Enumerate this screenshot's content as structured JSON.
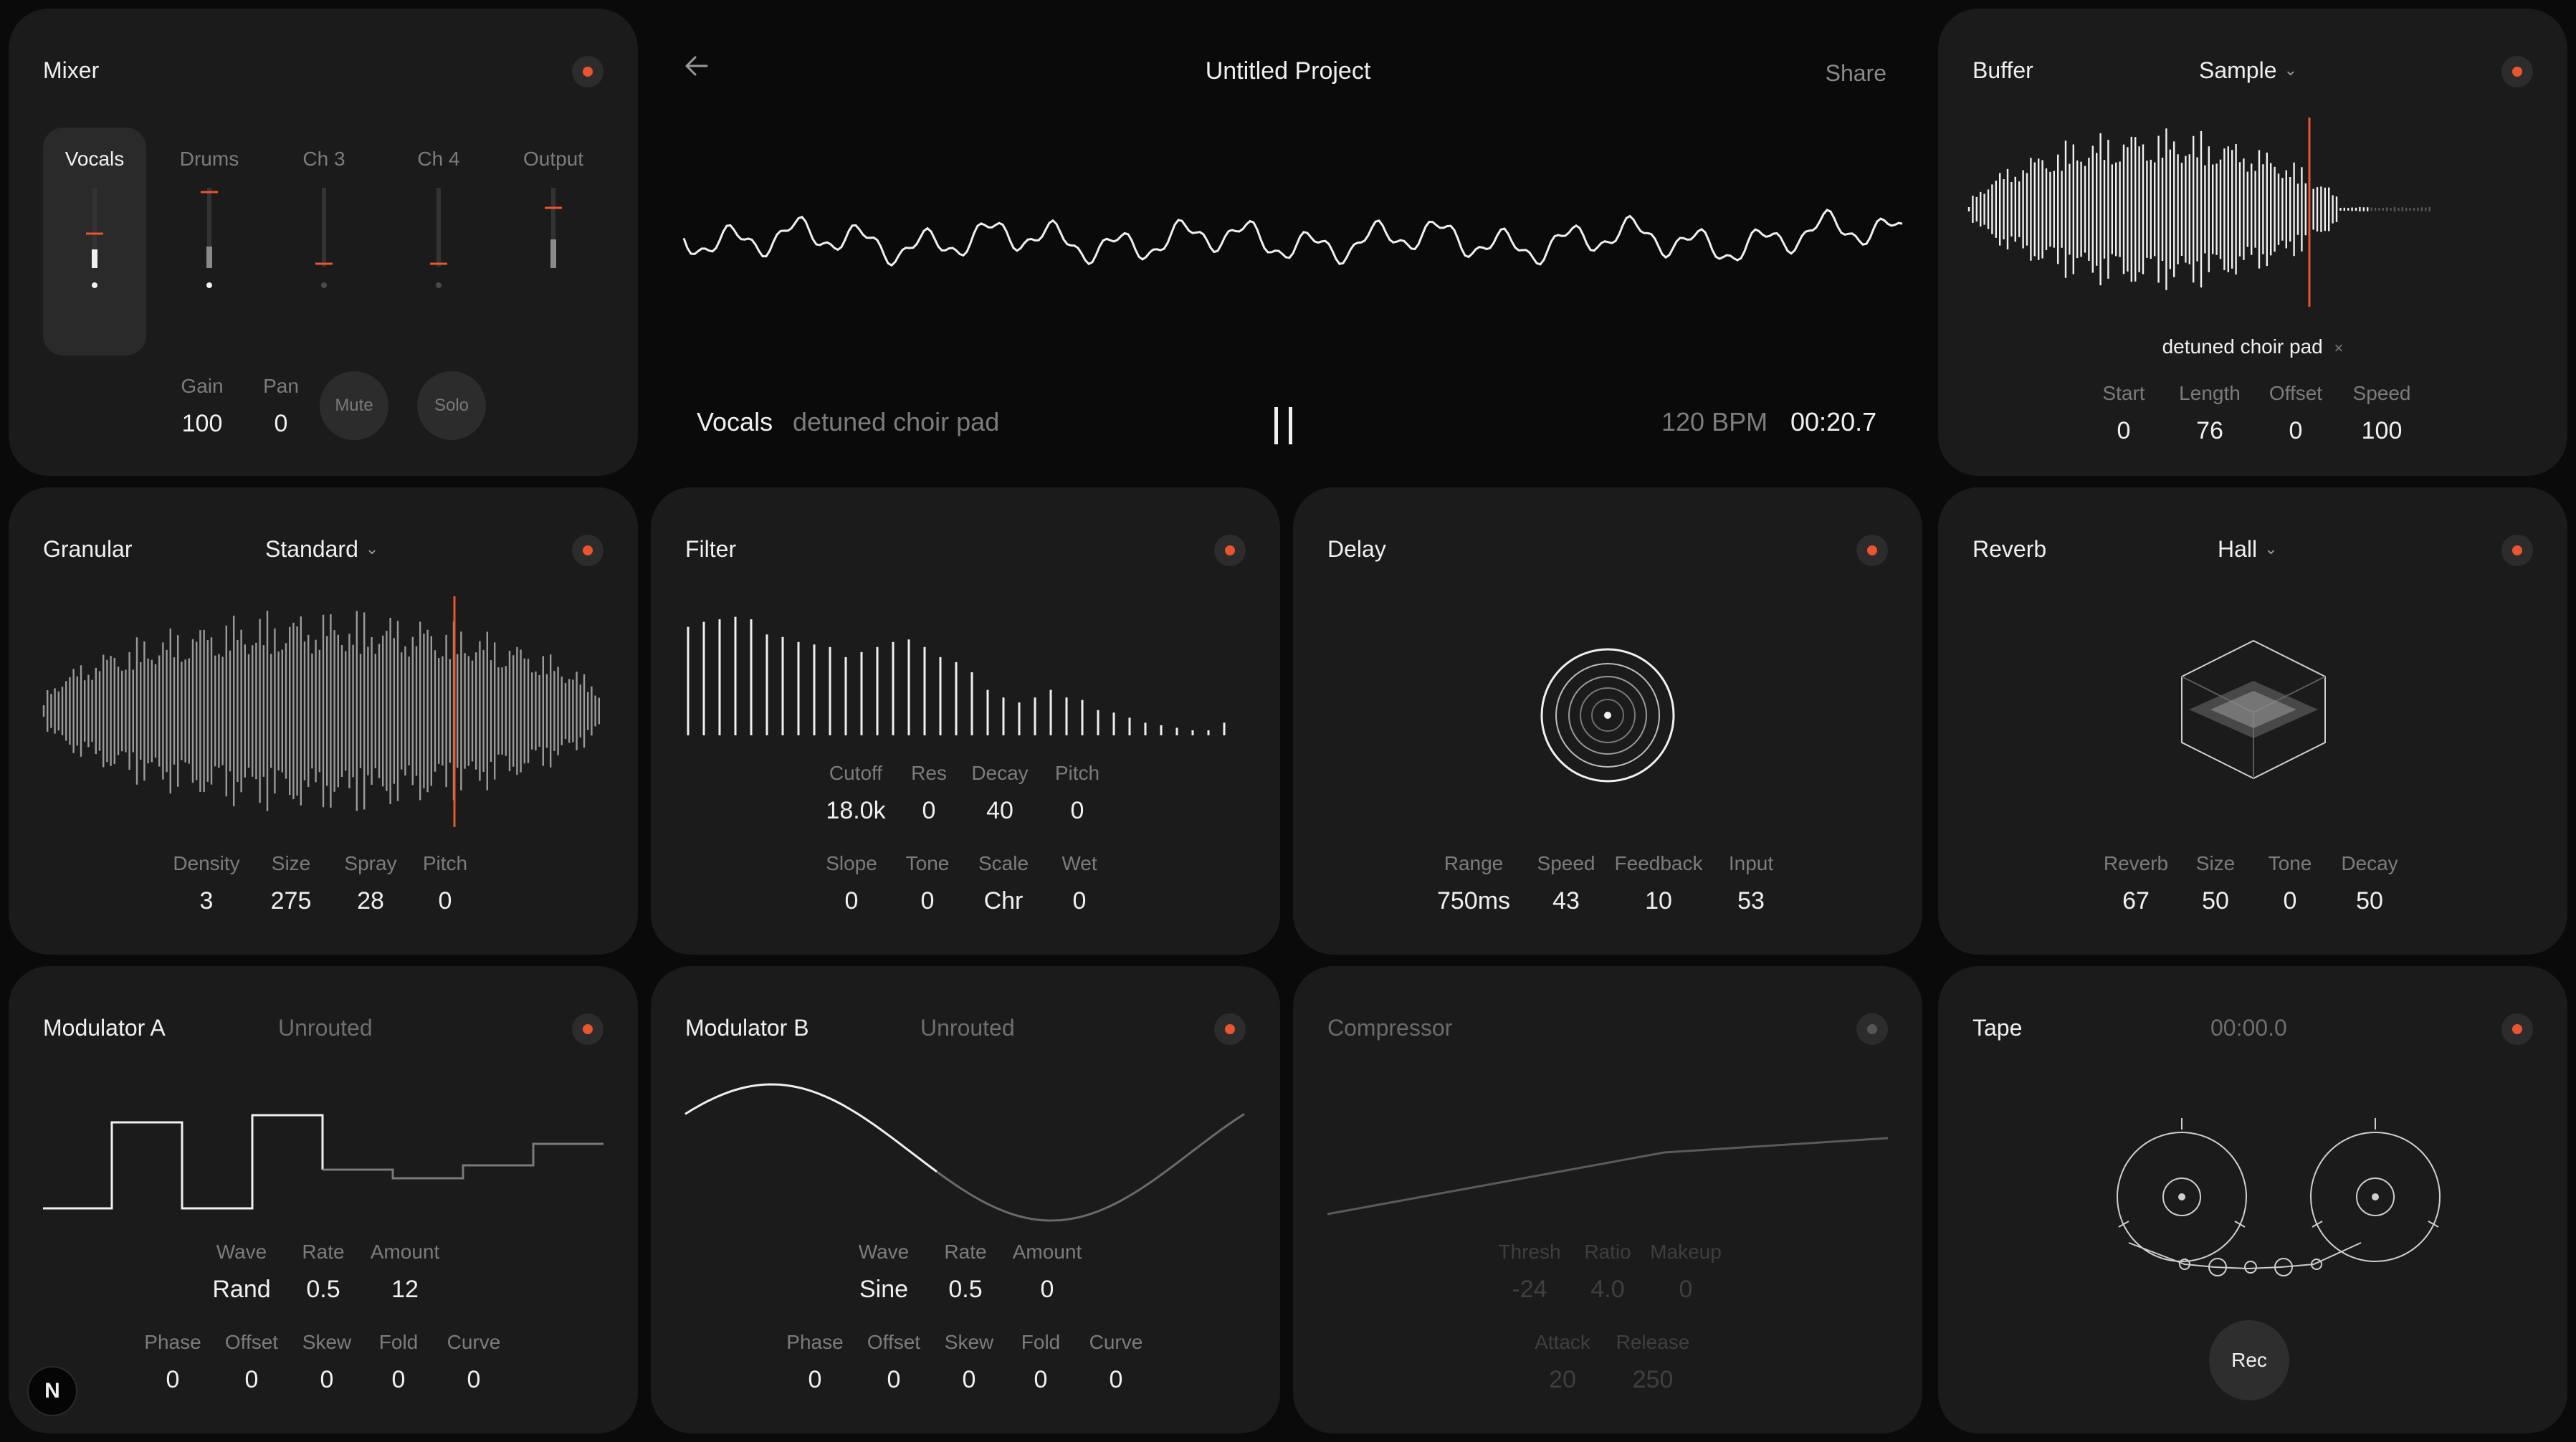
{
  "project": {
    "title": "Untitled Project",
    "share_label": "Share",
    "back_icon": "arrow-left-icon",
    "track_name": "Vocals",
    "sample_name": "detuned choir pad",
    "bpm": "120 BPM",
    "time": "00:20.7",
    "transport_icon": "pause-icon"
  },
  "accent_color": "#e8552e",
  "mixer": {
    "title": "Mixer",
    "channels": [
      "Vocals",
      "Drums",
      "Ch 3",
      "Ch 4",
      "Output"
    ],
    "selected_channel": "Vocals",
    "params": [
      {
        "label": "Gain",
        "value": "100"
      },
      {
        "label": "Pan",
        "value": "0"
      }
    ],
    "mute_label": "Mute",
    "solo_label": "Solo"
  },
  "buffer": {
    "title": "Buffer",
    "mode": "Sample",
    "sample_name": "detuned choir pad",
    "remove_icon": "×",
    "params": [
      {
        "label": "Start",
        "value": "0"
      },
      {
        "label": "Length",
        "value": "76"
      },
      {
        "label": "Offset",
        "value": "0"
      },
      {
        "label": "Speed",
        "value": "100"
      }
    ]
  },
  "granular": {
    "title": "Granular",
    "mode": "Standard",
    "params": [
      {
        "label": "Density",
        "value": "3"
      },
      {
        "label": "Size",
        "value": "275"
      },
      {
        "label": "Spray",
        "value": "28"
      },
      {
        "label": "Pitch",
        "value": "0"
      }
    ]
  },
  "filter": {
    "title": "Filter",
    "params_row1": [
      {
        "label": "Cutoff",
        "value": "18.0k"
      },
      {
        "label": "Res",
        "value": "0"
      },
      {
        "label": "Decay",
        "value": "40"
      },
      {
        "label": "Pitch",
        "value": "0"
      }
    ],
    "params_row2": [
      {
        "label": "Slope",
        "value": "0"
      },
      {
        "label": "Tone",
        "value": "0"
      },
      {
        "label": "Scale",
        "value": "Chr"
      },
      {
        "label": "Wet",
        "value": "0"
      }
    ]
  },
  "delay": {
    "title": "Delay",
    "params": [
      {
        "label": "Range",
        "value": "750ms"
      },
      {
        "label": "Speed",
        "value": "43"
      },
      {
        "label": "Feedback",
        "value": "10"
      },
      {
        "label": "Input",
        "value": "53"
      }
    ]
  },
  "reverb": {
    "title": "Reverb",
    "mode": "Hall",
    "params": [
      {
        "label": "Reverb",
        "value": "67"
      },
      {
        "label": "Size",
        "value": "50"
      },
      {
        "label": "Tone",
        "value": "0"
      },
      {
        "label": "Decay",
        "value": "50"
      }
    ]
  },
  "modulator_a": {
    "title": "Modulator A",
    "routing": "Unrouted",
    "params_row1": [
      {
        "label": "Wave",
        "value": "Rand"
      },
      {
        "label": "Rate",
        "value": "0.5"
      },
      {
        "label": "Amount",
        "value": "12"
      }
    ],
    "params_row2": [
      {
        "label": "Phase",
        "value": "0"
      },
      {
        "label": "Offset",
        "value": "0"
      },
      {
        "label": "Skew",
        "value": "0"
      },
      {
        "label": "Fold",
        "value": "0"
      },
      {
        "label": "Curve",
        "value": "0"
      }
    ]
  },
  "modulator_b": {
    "title": "Modulator B",
    "routing": "Unrouted",
    "params_row1": [
      {
        "label": "Wave",
        "value": "Sine"
      },
      {
        "label": "Rate",
        "value": "0.5"
      },
      {
        "label": "Amount",
        "value": "0"
      }
    ],
    "params_row2": [
      {
        "label": "Phase",
        "value": "0"
      },
      {
        "label": "Offset",
        "value": "0"
      },
      {
        "label": "Skew",
        "value": "0"
      },
      {
        "label": "Fold",
        "value": "0"
      },
      {
        "label": "Curve",
        "value": "0"
      }
    ]
  },
  "compressor": {
    "title": "Compressor",
    "enabled": false,
    "params_row1": [
      {
        "label": "Thresh",
        "value": "-24"
      },
      {
        "label": "Ratio",
        "value": "4.0"
      },
      {
        "label": "Makeup",
        "value": "0"
      }
    ],
    "params_row2": [
      {
        "label": "Attack",
        "value": "20"
      },
      {
        "label": "Release",
        "value": "250"
      }
    ]
  },
  "tape": {
    "title": "Tape",
    "time": "00:00.0",
    "rec_label": "Rec"
  },
  "logo": "N"
}
